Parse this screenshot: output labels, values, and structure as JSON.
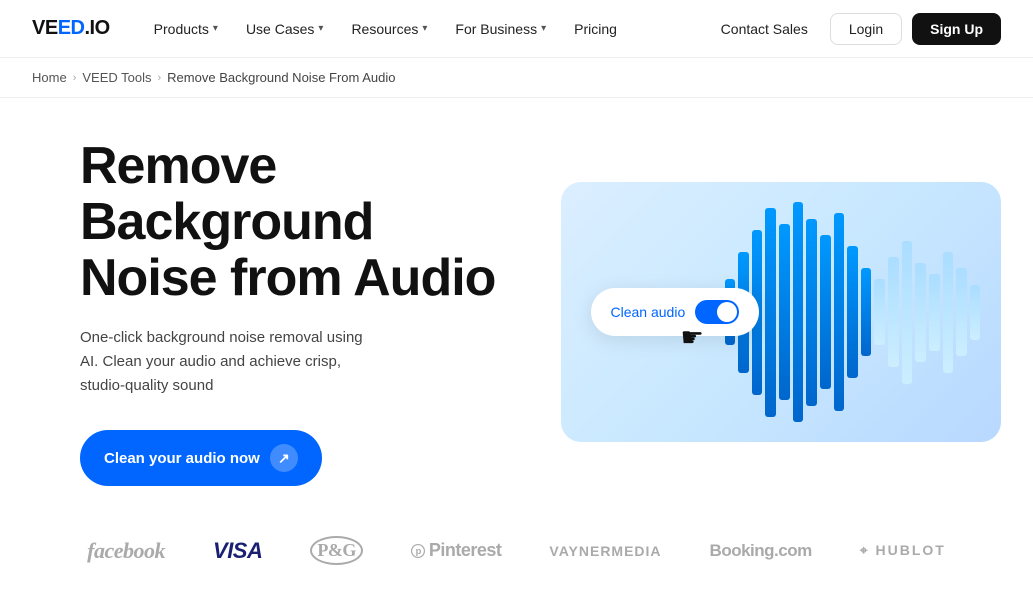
{
  "nav": {
    "logo": "VEED.IO",
    "links": [
      {
        "label": "Products",
        "hasDropdown": true
      },
      {
        "label": "Use Cases",
        "hasDropdown": true
      },
      {
        "label": "Resources",
        "hasDropdown": true
      },
      {
        "label": "For Business",
        "hasDropdown": true
      },
      {
        "label": "Pricing",
        "hasDropdown": false
      }
    ],
    "contact_label": "Contact Sales",
    "login_label": "Login",
    "signup_label": "Sign Up"
  },
  "breadcrumb": {
    "home": "Home",
    "tools": "VEED Tools",
    "current": "Remove Background Noise From Audio"
  },
  "hero": {
    "title": "Remove Background Noise from Audio",
    "description": "One-click background noise removal using AI. Clean your audio and achieve crisp, studio-quality sound",
    "cta_label": "Clean your audio now",
    "toggle_label": "Clean audio"
  },
  "logos": [
    {
      "id": "facebook",
      "label": "facebook",
      "class": "facebook"
    },
    {
      "id": "visa",
      "label": "VISA",
      "class": "visa"
    },
    {
      "id": "pg",
      "label": "P&G",
      "class": "pg"
    },
    {
      "id": "pinterest",
      "label": "● Pinterest",
      "class": "pinterest"
    },
    {
      "id": "vayner",
      "label": "VAYNERMEDIA",
      "class": "vayner"
    },
    {
      "id": "booking",
      "label": "Booking.com",
      "class": "booking"
    },
    {
      "id": "hublot",
      "label": "⌖ HUBLOT",
      "class": "hublot"
    }
  ]
}
